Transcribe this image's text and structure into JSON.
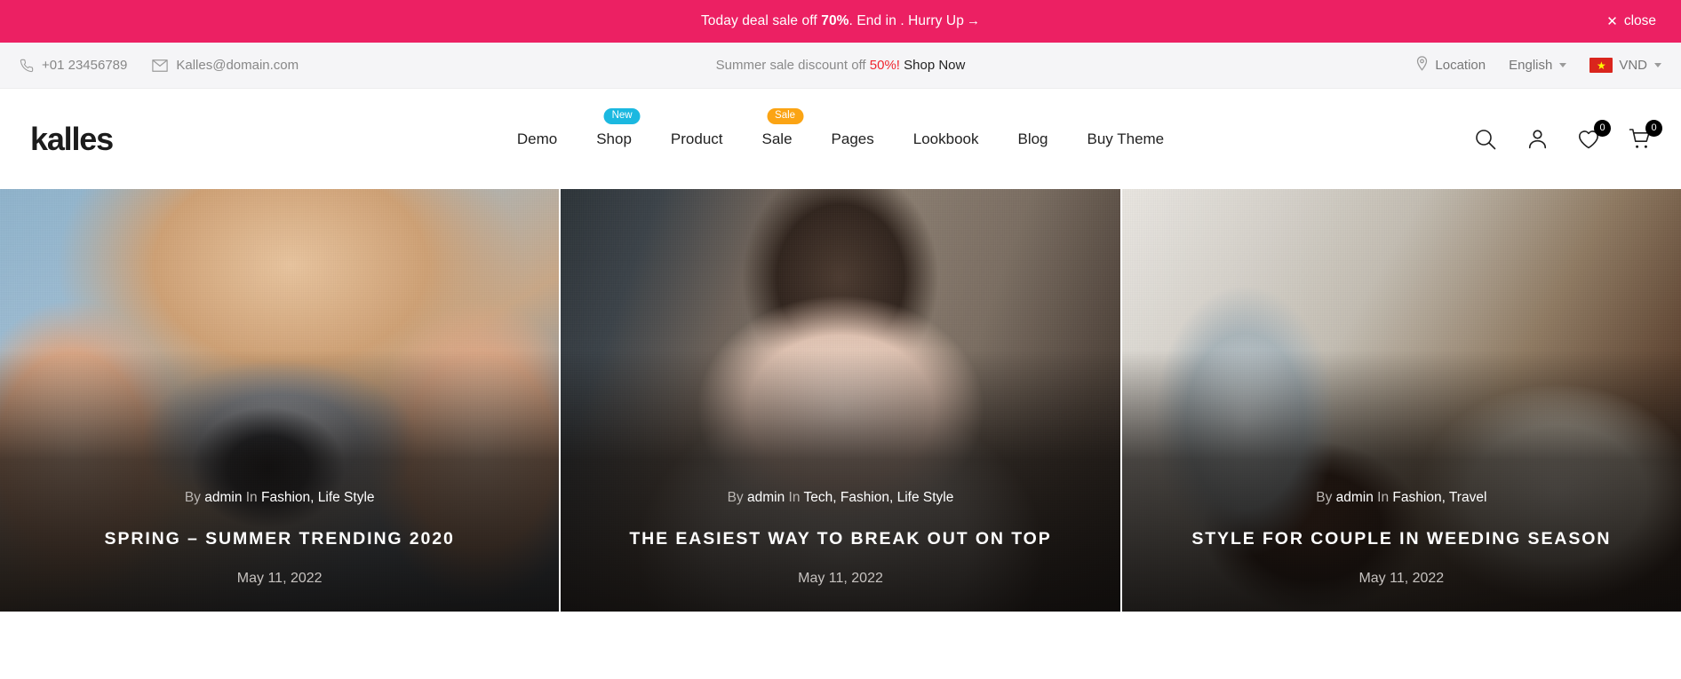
{
  "promo": {
    "text_before": "Today deal sale off ",
    "highlight": "70%",
    "text_after": ". End in . Hurry Up",
    "arrow": "→",
    "close_label": "close",
    "close_icon": "✕",
    "bg_color": "#ec2063"
  },
  "infobar": {
    "phone": "+01 23456789",
    "email": "Kalles@domain.com",
    "center_before": "Summer sale discount off ",
    "center_percent": "50%!",
    "center_link": "Shop Now",
    "location": "Location",
    "language": "English",
    "currency": "VND",
    "percent_color": "#f0262f"
  },
  "header": {
    "logo": "kalles",
    "nav": [
      {
        "label": "Demo",
        "badge": null
      },
      {
        "label": "Shop",
        "badge": "New",
        "badge_kind": "new"
      },
      {
        "label": "Product",
        "badge": null
      },
      {
        "label": "Sale",
        "badge": "Sale",
        "badge_kind": "sale"
      },
      {
        "label": "Pages",
        "badge": null
      },
      {
        "label": "Lookbook",
        "badge": null
      },
      {
        "label": "Blog",
        "badge": null
      },
      {
        "label": "Buy Theme",
        "badge": null
      }
    ],
    "wishlist_count": "0",
    "cart_count": "0",
    "badge_new_color": "#1bb8e0",
    "badge_sale_color": "#fba414"
  },
  "posts": [
    {
      "by_label": "By",
      "author": "admin",
      "in_label": "In",
      "categories": "Fashion, Life Style",
      "title": "SPRING – SUMMER TRENDING 2020",
      "date": "May 11, 2022"
    },
    {
      "by_label": "By",
      "author": "admin",
      "in_label": "In",
      "categories": "Tech, Fashion, Life Style",
      "title": "THE EASIEST WAY TO BREAK OUT ON TOP",
      "date": "May 11, 2022"
    },
    {
      "by_label": "By",
      "author": "admin",
      "in_label": "In",
      "categories": "Fashion, Travel",
      "title": "STYLE FOR COUPLE IN WEEDING SEASON",
      "date": "May 11, 2022"
    }
  ]
}
